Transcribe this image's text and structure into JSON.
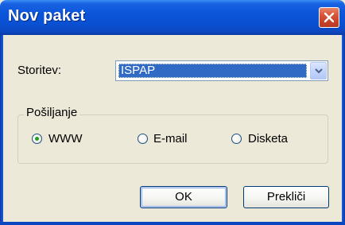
{
  "window": {
    "title": "Nov paket"
  },
  "form": {
    "service_label": "Storitev:",
    "service_value": "ISPAP"
  },
  "sending": {
    "legend": "Pošiljanje",
    "options": [
      {
        "label": "WWW",
        "selected": true
      },
      {
        "label": "E-mail",
        "selected": false
      },
      {
        "label": "Disketa",
        "selected": false
      }
    ]
  },
  "buttons": {
    "ok": "OK",
    "cancel": "Prekliči"
  },
  "colors": {
    "titlebar": "#0a54d9",
    "close_button": "#d9573a",
    "selection": "#316ac5",
    "dialog_bg": "#ece9d8",
    "radio_dot": "#21a121"
  },
  "icons": {
    "close": "close-icon",
    "dropdown": "chevron-down-icon"
  }
}
